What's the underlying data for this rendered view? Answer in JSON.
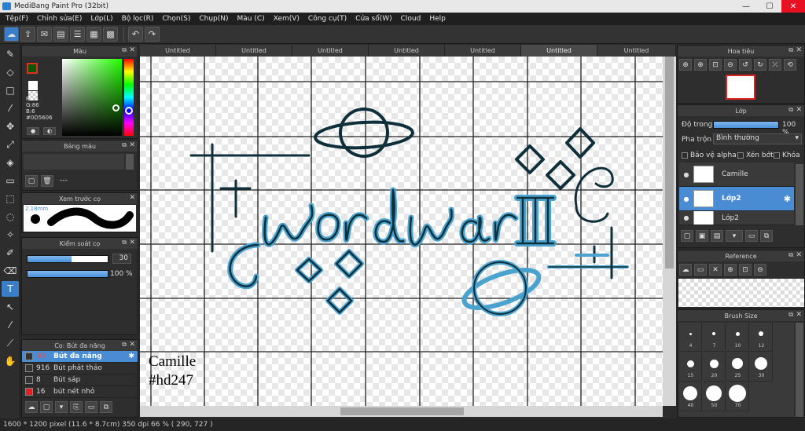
{
  "window": {
    "title": "MediBang Paint Pro (32bit)",
    "minimize": "—",
    "maximize": "☐",
    "close": "✕"
  },
  "menu": [
    "Tệp(F)",
    "Chỉnh sửa(E)",
    "Lớp(L)",
    "Bộ lọc(R)",
    "Chọn(S)",
    "Chụp(N)",
    "Màu (C)",
    "Xem(V)",
    "Công cụ(T)",
    "Cửa sổ(W)",
    "Cloud",
    "Help"
  ],
  "tabs": [
    "Untitled",
    "Untitled",
    "Untitled",
    "Untitled",
    "Untitled",
    "Untitled",
    "Untitled"
  ],
  "color_panel": {
    "title": "Màu",
    "r": "R:13",
    "g": "G:86",
    "b": "B:6",
    "hex": "#0D5606",
    "primary_color": "#0D5606"
  },
  "palette_panel": {
    "title": "Bảng màu",
    "empty": "---"
  },
  "preview_panel": {
    "title": "Xem trước cọ",
    "size": "2.18mm"
  },
  "control_panel": {
    "title": "Kiểm soát cọ",
    "size_value": "30",
    "opacity_value": "100 %",
    "size_fraction": 0.55,
    "opacity_fraction": 1.0
  },
  "brush_panel": {
    "title": "Cọ: Bút đa năng",
    "brushes": [
      {
        "size": "30",
        "name": "Bút đa năng",
        "color": "#333333",
        "selected": true
      },
      {
        "size": "916",
        "name": "Bút phát thảo",
        "color": "#333333",
        "selected": false
      },
      {
        "size": "8",
        "name": "Bút sáp",
        "color": "#333333",
        "selected": false
      },
      {
        "size": "16",
        "name": "bút nét nhỏ",
        "color": "#e02020",
        "selected": false
      }
    ]
  },
  "navigator": {
    "title": "Hoa tiêu"
  },
  "layer_panel": {
    "title": "Lớp",
    "opacity_label": "Độ trong",
    "opacity_value": "100 %",
    "opacity_fraction": 1.0,
    "blend_label": "Pha trộn",
    "blend_value": "Bình thường",
    "protect_alpha": "Bảo vệ alpha",
    "clipping": "Xén bớt",
    "lock": "Khóa",
    "layers": [
      {
        "name": "Camille",
        "selected": false
      },
      {
        "name": "Lớp2",
        "selected": true
      },
      {
        "name": "Lớp2",
        "selected": false
      }
    ]
  },
  "reference_panel": {
    "title": "Reference"
  },
  "brush_size_panel": {
    "title": "Brush Size",
    "sizes": [
      "4",
      "7",
      "10",
      "12",
      "15",
      "20",
      "25",
      "30",
      "40",
      "50",
      "70"
    ]
  },
  "canvas": {
    "signature_line1": "Camille",
    "signature_line2": "#hd247",
    "artwork_text": "wordwar III"
  },
  "status": {
    "info": "1600 * 1200 pixel   (11.6 * 8.7cm)   350 dpi   66 %   ( 290, 727 )"
  }
}
